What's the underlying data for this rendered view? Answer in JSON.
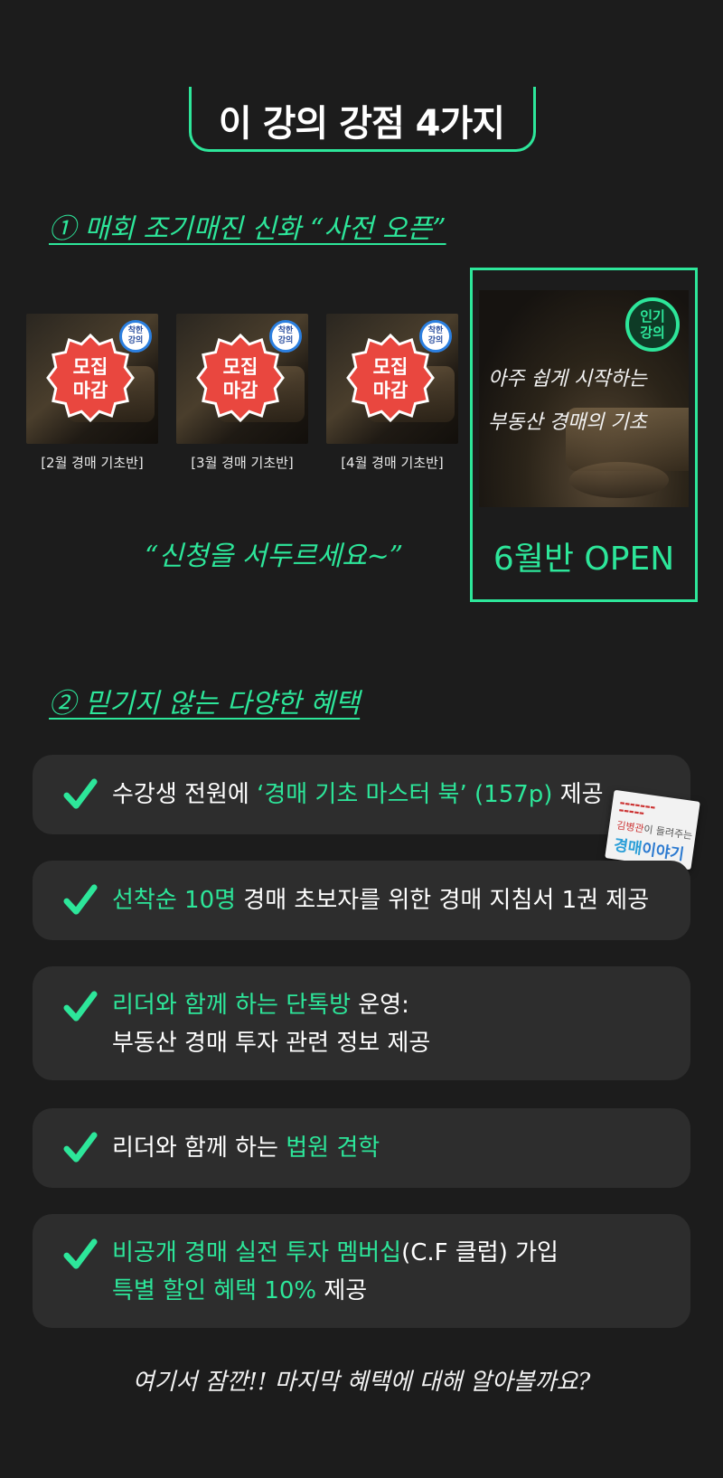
{
  "header": {
    "title": "이 강의 강점 4가지"
  },
  "section1": {
    "heading": "① 매회 조기매진 신화 “사전 오픈”",
    "past_classes": [
      {
        "caption": "[2월 경매 기초반]",
        "badge": "착한\n강의",
        "status_line1": "모집",
        "status_line2": "마감"
      },
      {
        "caption": "[3월 경매 기초반]",
        "badge": "착한\n강의",
        "status_line1": "모집",
        "status_line2": "마감"
      },
      {
        "caption": "[4월 경매 기초반]",
        "badge": "착한\n강의",
        "status_line1": "모집",
        "status_line2": "마감"
      }
    ],
    "hurry_text": "“신청을 서두르세요~”",
    "featured": {
      "badge_line1": "인기",
      "badge_line2": "강의",
      "line1": "아주 쉽게 시작하는",
      "line2": "부동산 경매의 기초",
      "open_label": "6월반 OPEN"
    }
  },
  "section2": {
    "heading": "② 믿기지 않는 다양한 혜택",
    "benefits": [
      {
        "pre": "수강생 전원에 ",
        "hl": "‘경매 기초 마스터 북’ (157p)",
        "post": " 제공"
      },
      {
        "hl": "선착순 10명",
        "post": " 경매 초보자를 위한 경매 지침서 1권 제공"
      },
      {
        "hl": "리더와 함께 하는 단톡방",
        "post": " 운영:",
        "line2": "부동산 경매 투자 관련 정보 제공"
      },
      {
        "pre": "리더와 함께 하는 ",
        "hl": "법원 견학"
      },
      {
        "hl": "비공개 경매 실전 투자 멤버십",
        "post": "(C.F 클럽) 가입",
        "line2_hl": "특별 할인 혜택 10%",
        "line2_post": " 제공"
      }
    ],
    "book": {
      "author_pre": "김병관",
      "author_post": "이 들려주는",
      "title_hl": "경매",
      "title_post": "이야기"
    }
  },
  "footer": {
    "teaser": "여기서 잠깐!! 마지막 혜택에 대해 알아볼까요?"
  },
  "colors": {
    "accent": "#2de69a",
    "background": "#1c1c1c",
    "card": "#2d2d2d",
    "closed_badge": "#e9473f"
  }
}
